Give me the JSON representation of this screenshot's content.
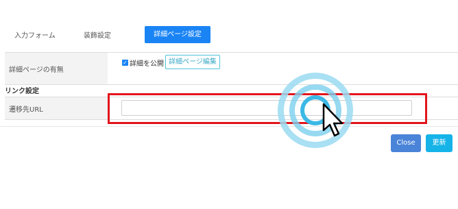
{
  "tabs": [
    {
      "label": "入力フォーム",
      "active": false
    },
    {
      "label": "装飾設定",
      "active": false
    },
    {
      "label": "詳細ページ設定",
      "active": true
    }
  ],
  "detail_row": {
    "label": "詳細ページの有無",
    "checkbox_label": "詳細を公開",
    "checkbox_checked": true,
    "edit_button_label": "詳細ページ編集"
  },
  "link_section": {
    "title": "リンク設定",
    "url_label": "遷移先URL",
    "url_value": ""
  },
  "footer": {
    "close_label": "Close",
    "update_label": "更新"
  },
  "colors": {
    "accent_blue": "#1a84f5",
    "highlight_red": "#e3141c",
    "close_button": "#4a84d8",
    "update_button": "#16b3e8"
  },
  "icons": {
    "cursor": "mouse-pointer-icon",
    "click_indicator": "click-ripple-icon",
    "checkbox": "checkmark-icon"
  }
}
